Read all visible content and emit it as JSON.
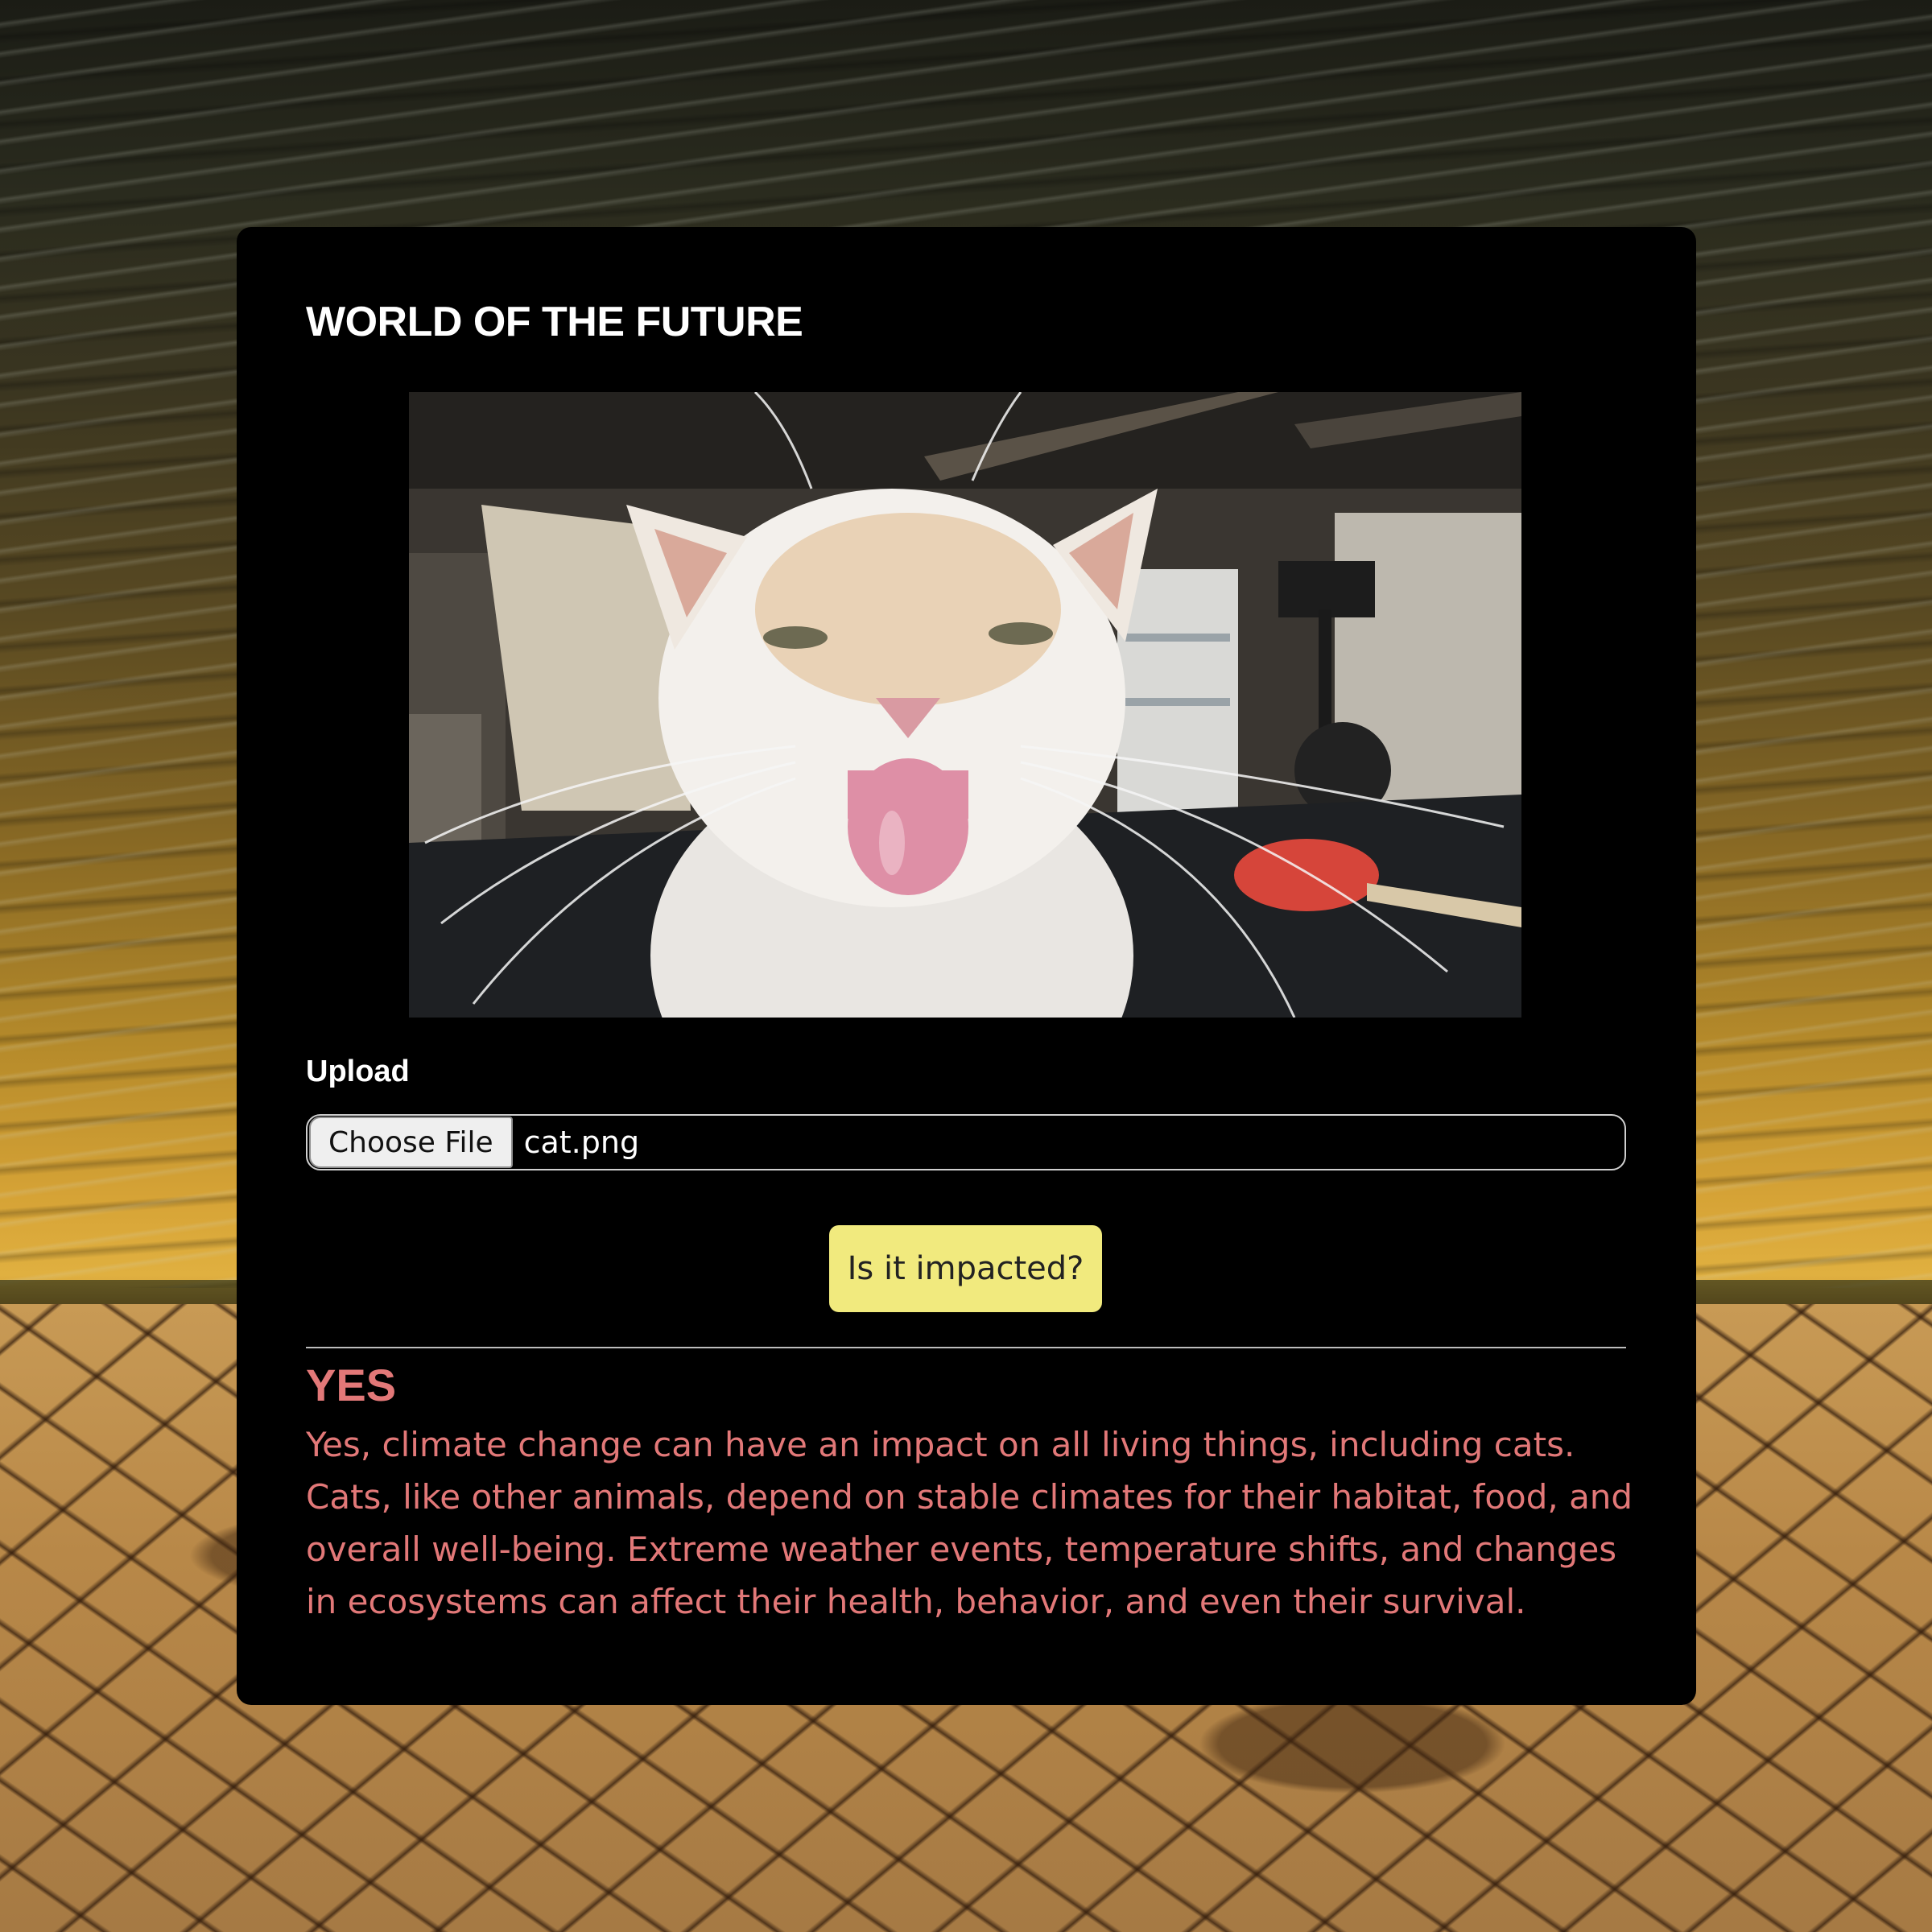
{
  "page": {
    "title": "WORLD OF THE FUTURE",
    "background_image": "apocalyptic-sky-cracked-earth"
  },
  "preview": {
    "image": "cat-sticking-tongue-out-photo"
  },
  "upload": {
    "label": "Upload",
    "choose_button": "Choose File",
    "file_name": "cat.png"
  },
  "actions": {
    "submit_label": "Is it impacted?"
  },
  "result": {
    "heading": "YES",
    "body": "Yes, climate change can have an impact on all living things, including cats. Cats, like other animals, depend on stable climates for their habitat, food, and overall well-being. Extreme weather events, temperature shifts, and changes in ecosystems can affect their health, behavior, and even their survival."
  },
  "colors": {
    "card_background": "#000000",
    "button_background": "#f1ea7e",
    "result_text": "#e27878",
    "title_text": "#ffffff"
  }
}
